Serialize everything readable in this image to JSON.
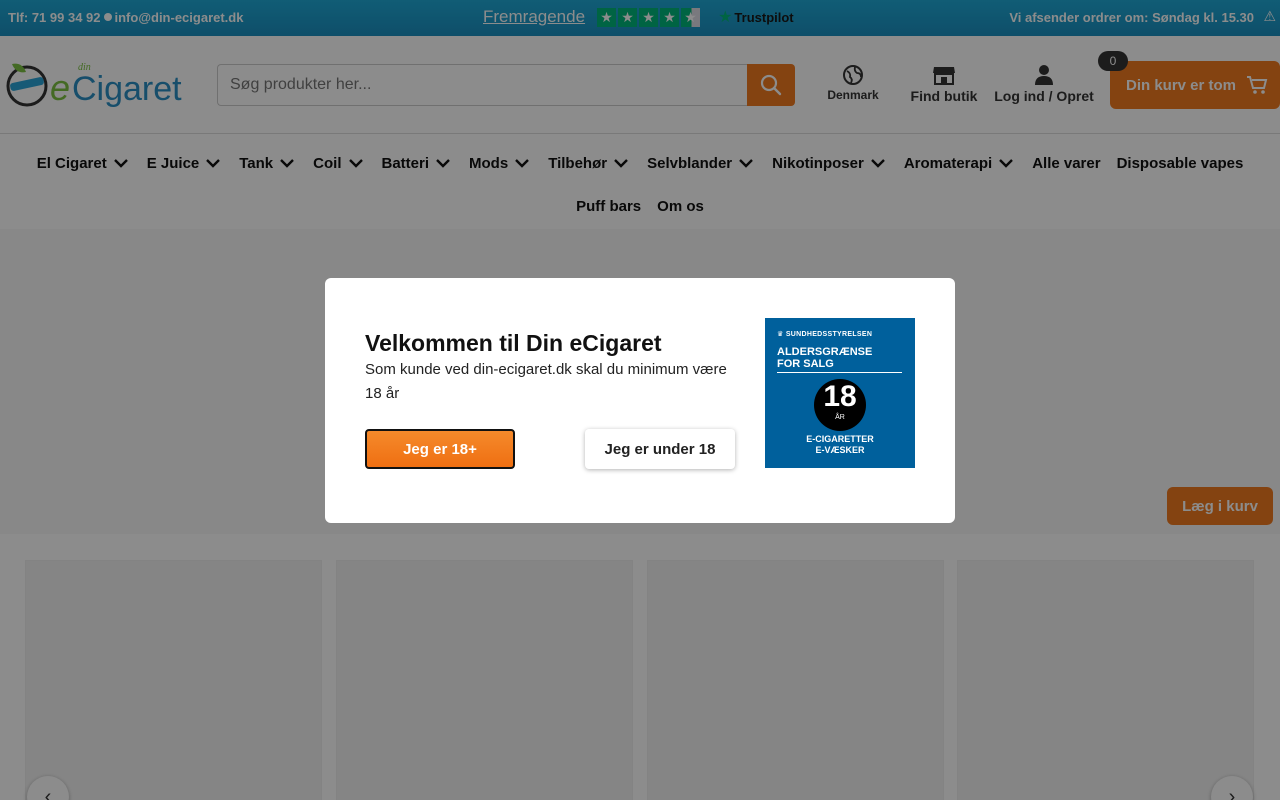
{
  "topbar": {
    "phone": "Tlf: 71 99 34 92",
    "email": "info@din-ecigaret.dk",
    "rating_label": "Fremragende",
    "trustpilot": "Trustpilot",
    "shipping": "Vi afsender ordrer om: Søndag kl. 15.30"
  },
  "header": {
    "search_placeholder": "Søg produkter her...",
    "country": "Denmark",
    "find_store": "Find butik",
    "login": "Log ind / Opret",
    "cart_label": "Din kurv er tom",
    "cart_count": "0"
  },
  "nav": {
    "items": [
      {
        "label": "El Cigaret"
      },
      {
        "label": "E Juice"
      },
      {
        "label": "Tank"
      },
      {
        "label": "Coil"
      },
      {
        "label": "Batteri"
      },
      {
        "label": "Mods"
      },
      {
        "label": "Tilbehør"
      },
      {
        "label": "Selvblander"
      },
      {
        "label": "Nikotinposer"
      },
      {
        "label": "Aromaterapi"
      },
      {
        "label": "Alle varer"
      },
      {
        "label": "Disposable vapes"
      },
      {
        "label": "Puff bars"
      },
      {
        "label": "Om os"
      }
    ]
  },
  "page": {
    "add_to_cart": "Læg i kurv"
  },
  "modal": {
    "title": "Velkommen til Din eCigaret",
    "text": "Som kunde ved din-ecigaret.dk skal du minimum være 18 år",
    "confirm": "Jeg er 18+",
    "decline": "Jeg er under 18",
    "badge_org": "SUNDHEDSSTYRELSEN",
    "badge_title_1": "ALDERSGRÆNSE",
    "badge_title_2": "FOR SALG",
    "badge_age": "18",
    "badge_unit": "ÅR",
    "badge_line1": "E-CIGARETTER",
    "badge_line2": "E-VÆSKER"
  },
  "colors": {
    "accent": "#f07b20",
    "topbar": "#1b9bcc",
    "badge": "#00609c",
    "trustpilot": "#00b67a"
  }
}
